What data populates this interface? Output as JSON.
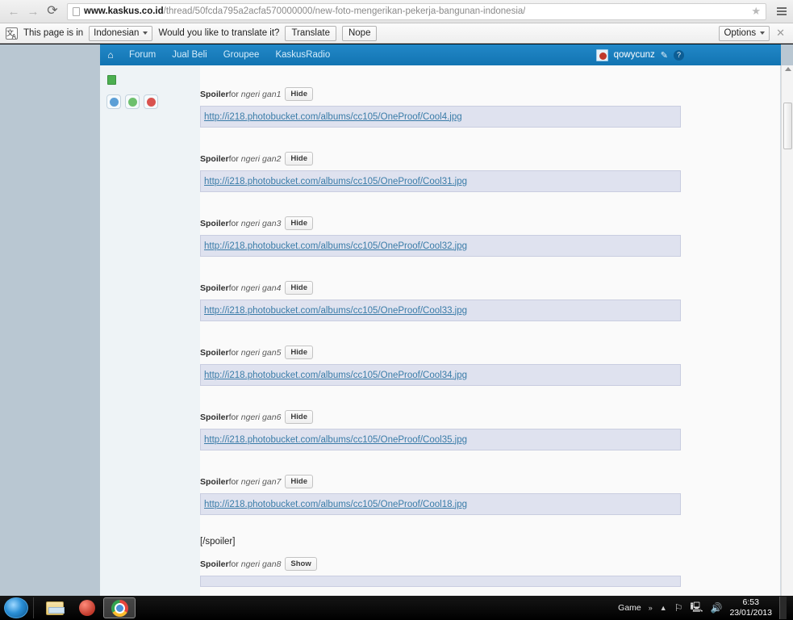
{
  "browser": {
    "back_icon": "back-arrow-icon",
    "forward_icon": "forward-arrow-icon",
    "reload_icon": "reload-icon",
    "url_domain": "www.kaskus.co.id",
    "url_path": "/thread/50fcda795a2acfa570000000/new-foto-mengerikan-pekerja-bangunan-indonesia/",
    "star_icon": "★",
    "menu_icon": "menu-icon"
  },
  "infobar": {
    "icon": "translate-icon",
    "message_prefix": "This page is in",
    "language": "Indonesian",
    "message_suffix": "Would you like to translate it?",
    "translate_label": "Translate",
    "nope_label": "Nope",
    "options_label": "Options",
    "close_label": "✕"
  },
  "site_nav": {
    "home_icon": "home-icon",
    "items": [
      {
        "label": "Forum"
      },
      {
        "label": "Jual Beli"
      },
      {
        "label": "Groupee"
      },
      {
        "label": "KaskusRadio"
      }
    ],
    "username": "qowycunz",
    "avatar": "user-avatar",
    "edit_icon": "✎",
    "help_icon": "?"
  },
  "sidebar": {
    "badge": "green-status-badge",
    "icons": [
      {
        "name": "profile-icon"
      },
      {
        "name": "message-icon"
      },
      {
        "name": "report-icon"
      }
    ]
  },
  "content": {
    "spoiler_word": "Spoiler",
    "for_word": "for",
    "hide_label": "Hide",
    "show_label": "Show",
    "closing_tag": "[/spoiler]",
    "spoilers": [
      {
        "title": "ngeri gan1",
        "button": "Hide",
        "link": "http://i218.photobucket.com/albums/cc105/OneProof/Cool4.jpg",
        "open": true
      },
      {
        "title": "ngeri gan2",
        "button": "Hide",
        "link": "http://i218.photobucket.com/albums/cc105/OneProof/Cool31.jpg",
        "open": true
      },
      {
        "title": "ngeri gan3",
        "button": "Hide",
        "link": "http://i218.photobucket.com/albums/cc105/OneProof/Cool32.jpg",
        "open": true
      },
      {
        "title": "ngeri gan4",
        "button": "Hide",
        "link": "http://i218.photobucket.com/albums/cc105/OneProof/Cool33.jpg",
        "open": true
      },
      {
        "title": "ngeri gan5",
        "button": "Hide",
        "link": "http://i218.photobucket.com/albums/cc105/OneProof/Cool34.jpg",
        "open": true
      },
      {
        "title": "ngeri gan6",
        "button": "Hide",
        "link": "http://i218.photobucket.com/albums/cc105/OneProof/Cool35.jpg",
        "open": true
      },
      {
        "title": "ngeri gan7",
        "button": "Hide",
        "link": "http://i218.photobucket.com/albums/cc105/OneProof/Cool18.jpg",
        "open": true
      },
      {
        "title": "ngeri gan8",
        "button": "Show",
        "link": "",
        "open": false
      }
    ]
  },
  "taskbar": {
    "start_label": "start-orb",
    "items": [
      {
        "name": "explorer-icon",
        "active": false
      },
      {
        "name": "red-app-icon",
        "active": false
      },
      {
        "name": "chrome-icon",
        "active": true
      }
    ],
    "tray_label": "Game",
    "overflow_icon": "»",
    "chevron_icon": "▲",
    "flag_icon": "⚐",
    "network_icon": "network-icon",
    "volume_icon": "volume-icon",
    "time": "6:53",
    "date": "23/01/2013"
  },
  "colors": {
    "kaskus_blue": "#1274b2",
    "link_blue": "#3a7ca8",
    "spoiler_bg": "#dfe2ef",
    "page_bg": "#b9c7d2"
  }
}
